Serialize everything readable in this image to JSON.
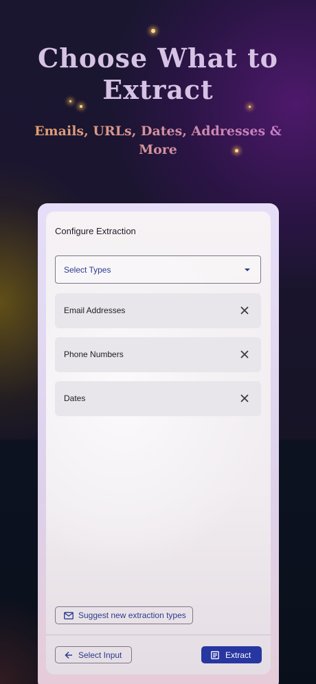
{
  "header": {
    "title": "Choose What to Extract",
    "subtitle": "Emails, URLs, Dates, Addresses & More"
  },
  "card": {
    "title": "Configure Extraction",
    "select": {
      "label": "Select Types"
    },
    "selected_types": [
      {
        "label": "Email Addresses"
      },
      {
        "label": "Phone Numbers"
      },
      {
        "label": "Dates"
      }
    ],
    "suggest_label": "Suggest new extraction types",
    "back_label": "Select Input",
    "extract_label": "Extract"
  },
  "colors": {
    "accent": "#2736a0",
    "title": "#d6c2e4",
    "chip": "#e8e6ea"
  },
  "icons": [
    "arrow-down-icon",
    "close-icon",
    "mail-icon",
    "arrow-left-icon",
    "document-icon"
  ]
}
